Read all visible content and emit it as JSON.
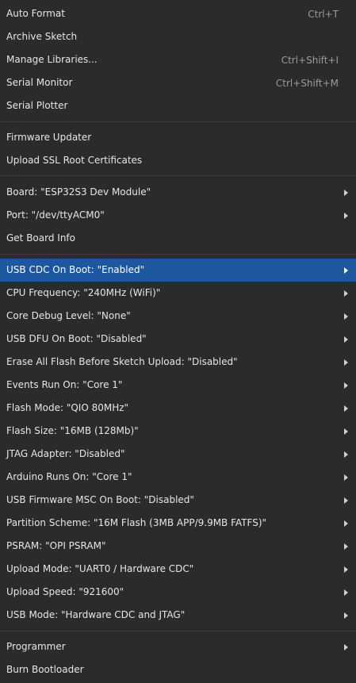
{
  "menu": {
    "items": [
      {
        "label": "Auto Format",
        "shortcut": "Ctrl+T"
      },
      {
        "label": "Archive Sketch",
        "shortcut": ""
      },
      {
        "label": "Manage Libraries...",
        "shortcut": "Ctrl+Shift+I"
      },
      {
        "label": "Serial Monitor",
        "shortcut": "Ctrl+Shift+M"
      },
      {
        "label": "Serial Plotter",
        "shortcut": ""
      },
      {
        "label": "Firmware Updater",
        "shortcut": ""
      },
      {
        "label": "Upload SSL Root Certificates",
        "shortcut": ""
      },
      {
        "label": "Board: \"ESP32S3 Dev Module\"",
        "submenu": true
      },
      {
        "label": "Port: \"/dev/ttyACM0\"",
        "submenu": true
      },
      {
        "label": "Get Board Info"
      },
      {
        "label": "USB CDC On Boot: \"Enabled\"",
        "submenu": true,
        "highlighted": true
      },
      {
        "label": "CPU Frequency: \"240MHz (WiFi)\"",
        "submenu": true
      },
      {
        "label": "Core Debug Level: \"None\"",
        "submenu": true
      },
      {
        "label": "USB DFU On Boot: \"Disabled\"",
        "submenu": true
      },
      {
        "label": "Erase All Flash Before Sketch Upload: \"Disabled\"",
        "submenu": true
      },
      {
        "label": "Events Run On: \"Core 1\"",
        "submenu": true
      },
      {
        "label": "Flash Mode: \"QIO 80MHz\"",
        "submenu": true
      },
      {
        "label": "Flash Size: \"16MB (128Mb)\"",
        "submenu": true
      },
      {
        "label": "JTAG Adapter: \"Disabled\"",
        "submenu": true
      },
      {
        "label": "Arduino Runs On: \"Core 1\"",
        "submenu": true
      },
      {
        "label": "USB Firmware MSC On Boot: \"Disabled\"",
        "submenu": true
      },
      {
        "label": "Partition Scheme: \"16M Flash (3MB APP/9.9MB FATFS)\"",
        "submenu": true
      },
      {
        "label": "PSRAM: \"OPI PSRAM\"",
        "submenu": true
      },
      {
        "label": "Upload Mode: \"UART0 / Hardware CDC\"",
        "submenu": true
      },
      {
        "label": "Upload Speed: \"921600\"",
        "submenu": true
      },
      {
        "label": "USB Mode: \"Hardware CDC and JTAG\"",
        "submenu": true
      },
      {
        "label": "Programmer",
        "submenu": true
      },
      {
        "label": "Burn Bootloader"
      }
    ]
  },
  "colors": {
    "background": "#2b2b2b",
    "highlight": "#1d579e",
    "text": "#e6e6e6",
    "shortcut": "#9a9a9a",
    "separator": "#3c3c3c"
  }
}
